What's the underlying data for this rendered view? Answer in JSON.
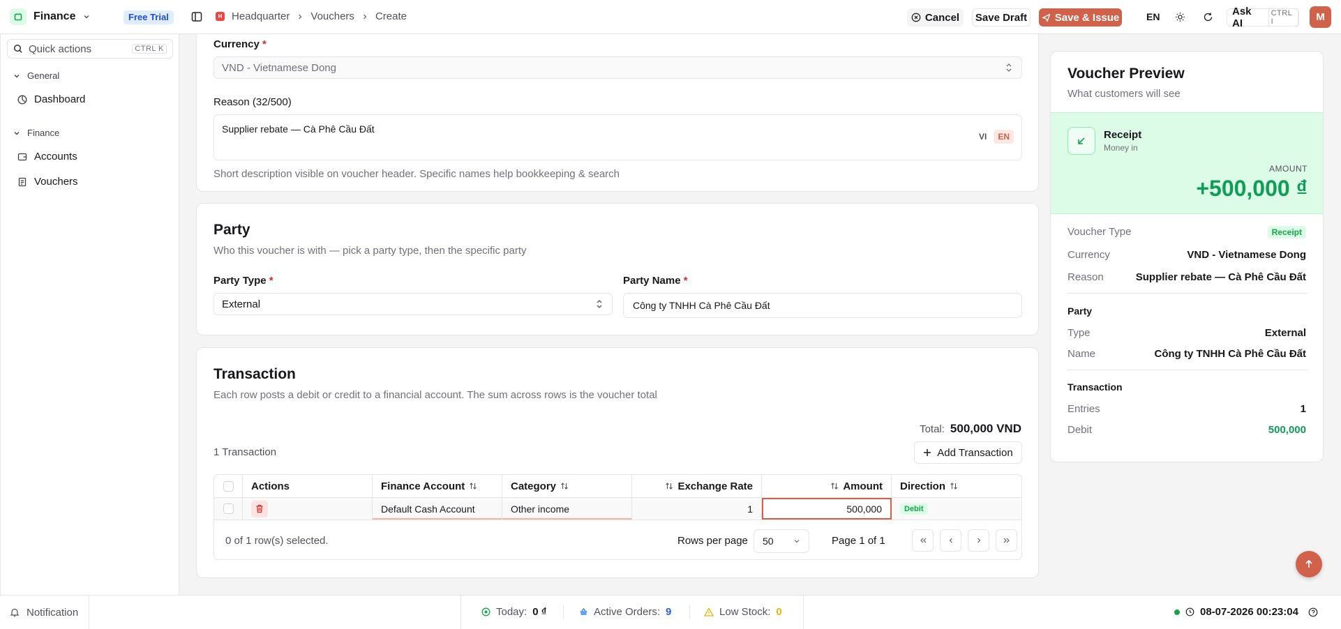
{
  "topbar": {
    "app_name": "Finance",
    "trial_badge": "Free Trial",
    "breadcrumb": [
      "Headquarter",
      "Vouchers",
      "Create"
    ],
    "cancel_label": "Cancel",
    "save_draft_label": "Save Draft",
    "save_issue_label": "Save & Issue",
    "language": "EN",
    "ask_ai_label": "Ask AI",
    "ask_ai_shortcut": "CTRL I",
    "avatar_initial": "M"
  },
  "sidebar": {
    "quick_actions_placeholder": "Quick actions",
    "quick_actions_shortcut": "CTRL K",
    "groups": [
      {
        "label": "General",
        "items": [
          {
            "label": "Dashboard",
            "icon": "dashboard-icon"
          }
        ]
      },
      {
        "label": "Finance",
        "items": [
          {
            "label": "Accounts",
            "icon": "wallet-icon"
          },
          {
            "label": "Vouchers",
            "icon": "receipt-icon"
          }
        ]
      }
    ]
  },
  "details": {
    "currency_label": "Currency",
    "currency_value": "VND - Vietnamese Dong",
    "reason_label": "Reason (32/500)",
    "reason_value": "Supplier rebate — Cà Phê Cầu Đất",
    "lang_toggle": [
      "VI",
      "EN"
    ],
    "reason_help": "Short description visible on voucher header. Specific names help bookkeeping & search"
  },
  "party": {
    "title": "Party",
    "subtitle": "Who this voucher is with — pick a party type, then the specific party",
    "type_label": "Party Type",
    "type_value": "External",
    "name_label": "Party Name",
    "name_value": "Công ty TNHH Cà Phê Cầu Đất"
  },
  "transaction": {
    "title": "Transaction",
    "subtitle": "Each row posts a debit or credit to a financial account. The sum across rows is the voucher total",
    "total_label": "Total:",
    "total_value": "500,000 VND",
    "count_label": "1 Transaction",
    "add_label": "Add Transaction",
    "columns": [
      "Actions",
      "Finance Account",
      "Category",
      "Exchange Rate",
      "Amount",
      "Direction"
    ],
    "rows": [
      {
        "account": "Default Cash Account",
        "category": "Other income",
        "rate": "1",
        "amount": "500,000",
        "direction": "Debit"
      }
    ],
    "selected_text": "0 of 1 row(s) selected.",
    "rows_per_page_label": "Rows per page",
    "rows_per_page_value": "50",
    "page_text": "Page 1 of 1"
  },
  "preview": {
    "title": "Voucher Preview",
    "subtitle": "What customers will see",
    "type_name": "Receipt",
    "type_sub": "Money in",
    "amount_label": "AMOUNT",
    "amount_value": "+500,000 ₫",
    "voucher_type_key": "Voucher Type",
    "voucher_type_value": "Receipt",
    "currency_key": "Currency",
    "currency_value": "VND - Vietnamese Dong",
    "reason_key": "Reason",
    "reason_value": "Supplier rebate — Cà Phê Cầu Đất",
    "party_heading": "Party",
    "party_type_key": "Type",
    "party_type_value": "External",
    "party_name_key": "Name",
    "party_name_value": "Công ty TNHH Cà Phê Cầu Đất",
    "txn_heading": "Transaction",
    "entries_key": "Entries",
    "entries_value": "1",
    "debit_key": "Debit",
    "debit_value": "500,000"
  },
  "statusbar": {
    "notification_label": "Notification",
    "today_label": "Today:",
    "today_value": "0 ₫",
    "orders_label": "Active Orders:",
    "orders_value": "9",
    "stock_label": "Low Stock:",
    "stock_value": "0",
    "datetime": "08-07-2026 00:23:04"
  },
  "colors": {
    "accent": "#d0614a",
    "green": "#16a34a",
    "preview_green_bg": "#dcfce7",
    "debit_green": "#0f9d58",
    "orders_blue": "#2563eb",
    "stock_amber": "#eab308"
  }
}
